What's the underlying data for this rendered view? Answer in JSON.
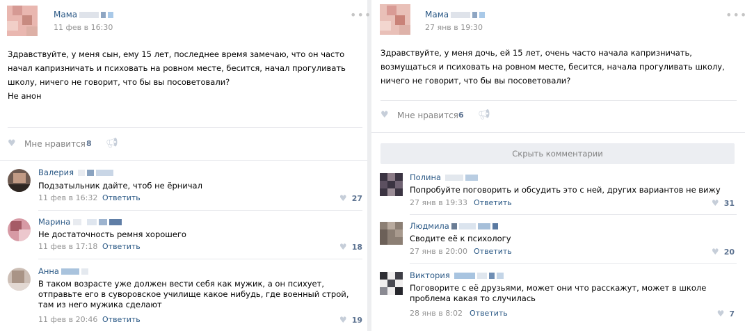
{
  "left_post": {
    "author": "Мама",
    "date": "11 фев в 16:30",
    "text": "Здравствуйте, у меня сын, ему 15 лет, последнее время замечаю, что он часто\nначал капризничать и психовать на ровном месте, бесится, начал прогуливать\nшколу, ничего не говорит, что бы вы посоветовали?\nНе анон",
    "like_label": "Мне нравится",
    "like_count": "8",
    "comments": [
      {
        "author": "Валерия",
        "text": "Подзатыльник дайте, чтоб не ёрничал",
        "date": "11 фев в 16:32",
        "reply": "Ответить",
        "likes": "27"
      },
      {
        "author": "Марина",
        "text": "Не достаточность ремня хорошего",
        "date": "11 фев в 17:18",
        "reply": "Ответить",
        "likes": "18"
      },
      {
        "author": "Анна",
        "text": "В таком возрасте уже должен вести себя как мужик, а он психует,\nотправьте его в суворовское училище какое нибудь, где военный строй,\nтам из него мужика сделают",
        "date": "11 фев в 20:46",
        "reply": "Ответить",
        "likes": "19"
      }
    ]
  },
  "right_post": {
    "author": "Мама",
    "date": "27 янв в 19:30",
    "text": "Здравствуйте, у меня дочь, ей 15 лет, очень часто начала капризничать,\nвозмущаться и психовать на ровном месте, бесится, начала прогуливать школу,\nничего не говорит, что бы вы посоветовали?",
    "like_label": "Мне нравится",
    "like_count": "6",
    "hide_comments": "Скрыть комментарии",
    "comments": [
      {
        "author": "Полина",
        "text": "Попробуйте поговорить и обсудить это с ней, других вариантов не вижу",
        "date": "27 янв в 19:33",
        "reply": "Ответить",
        "likes": "31"
      },
      {
        "author": "Людмила",
        "text": "Сводите её к психологу",
        "date": "27 янв в 20:00",
        "reply": "Ответить",
        "likes": "20"
      },
      {
        "author": "Виктория",
        "text": "Поговорите с её друзьями, может они что расскажут, может в школе\nпроблема какая то случилась",
        "date": "28 янв в 8:02",
        "reply": "Ответить",
        "likes": "7"
      }
    ]
  },
  "icons": {
    "like": "heart-icon",
    "share": "megaphone-icon",
    "more": "more-dots-icon"
  },
  "colors": {
    "link": "#2a5885",
    "meta": "#939393",
    "accent_count": "#5d7391",
    "icon": "#c6ced9",
    "divider": "#e7e8ec"
  }
}
